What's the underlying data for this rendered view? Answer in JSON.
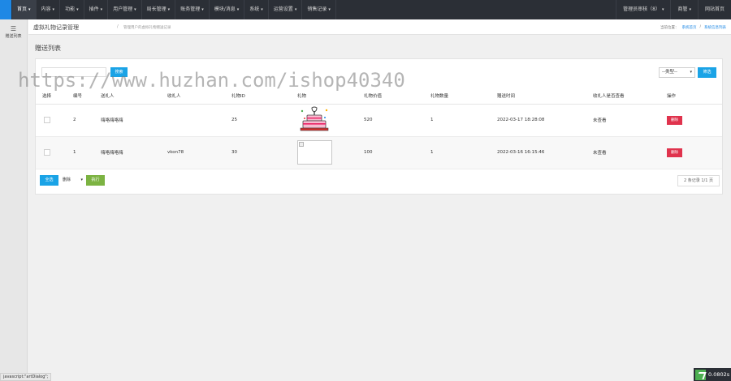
{
  "topnav": {
    "items": [
      {
        "label": "首页",
        "caret": "▾"
      },
      {
        "label": "内容",
        "caret": "▾"
      },
      {
        "label": "功能",
        "caret": "▾"
      },
      {
        "label": "插件",
        "caret": "▾"
      },
      {
        "label": "用户管理",
        "caret": "▾"
      },
      {
        "label": "局长管理",
        "caret": "▾"
      },
      {
        "label": "账务管理",
        "caret": "▾"
      },
      {
        "label": "模块/消息",
        "caret": "▾"
      },
      {
        "label": "系统",
        "caret": "▾"
      },
      {
        "label": "运营设置",
        "caret": "▾"
      },
      {
        "label": "销售记录",
        "caret": "▾"
      }
    ],
    "right": {
      "admin": "管理员审核（8）",
      "admin_caret": "▾",
      "shop": "商管",
      "shop_caret": "▾",
      "site": "网站首页"
    },
    "colors": {
      "bar": "#2b2f36",
      "accent": "#1e88e5"
    }
  },
  "sidebar": {
    "icon": "menu-list-icon",
    "icon_glyph": "☰",
    "label": "赠送列表"
  },
  "breadcrumb": {
    "title": "虚拟礼物记录管理",
    "separator": "/",
    "subtitle": "管理用户的虚拟礼物赠送记录",
    "path_label": "当前位置：",
    "path_home": "系统首页",
    "path_sep": "/",
    "path_current": "系统信息列表"
  },
  "page_heading": "赠送列表",
  "toolbar": {
    "search_value": "",
    "search_button": "搜索",
    "type_select": "--类型--",
    "type_chevron": "▾",
    "filter_button": "筛选"
  },
  "table": {
    "headers": [
      "选择",
      "编号",
      "送礼人",
      "收礼人",
      "礼物ID",
      "礼物",
      "礼物价值",
      "礼物数量",
      "赠送时间",
      "收礼人是否查看",
      "操作"
    ],
    "rows": [
      {
        "id": "2",
        "sender": "嗨咯嗨咯嗨",
        "receiver": "",
        "gift_id": "25",
        "gift_image": "cake-gift-icon",
        "value": "520",
        "quantity": "1",
        "time": "2022-03-17 18:28:08",
        "viewed": "未查看",
        "action": "删除"
      },
      {
        "id": "1",
        "sender": "嗨咯嗨咯嗨",
        "receiver": "vkon78",
        "gift_id": "30",
        "gift_image": "broken-image-icon",
        "value": "100",
        "quantity": "1",
        "time": "2022-03-16 16:15:46",
        "viewed": "未查看",
        "action": "删除"
      }
    ]
  },
  "bottom": {
    "select_all": "全选",
    "action_select": "删除",
    "action_chevron": "▾",
    "execute": "执行",
    "pager": "2 条记录 1/1 页"
  },
  "watermark": "https://www.huzhan.com/ishop40340",
  "statusbar": {
    "link": "javascript:\"artDialog\";",
    "timer": "0.0802s"
  }
}
